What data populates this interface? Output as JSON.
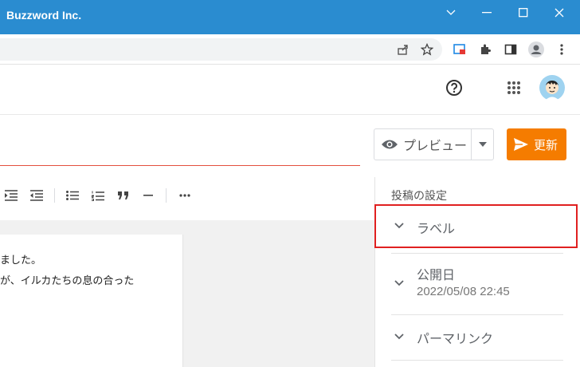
{
  "window": {
    "title": "Buzzword Inc."
  },
  "editor": {
    "preview_label": "プレビュー",
    "update_label": "更新",
    "body_lines": [
      "ました。",
      "が、イルカたちの息の合った"
    ]
  },
  "sidebar": {
    "section_title": "投稿の設定",
    "items": [
      {
        "label": "ラベル"
      },
      {
        "label": "公開日",
        "value": "2022/05/08 22:45"
      },
      {
        "label": "パーマリンク"
      }
    ]
  },
  "colors": {
    "titlebar": "#2a8cd0",
    "accent": "#f57c00",
    "highlight": "#e02020"
  }
}
